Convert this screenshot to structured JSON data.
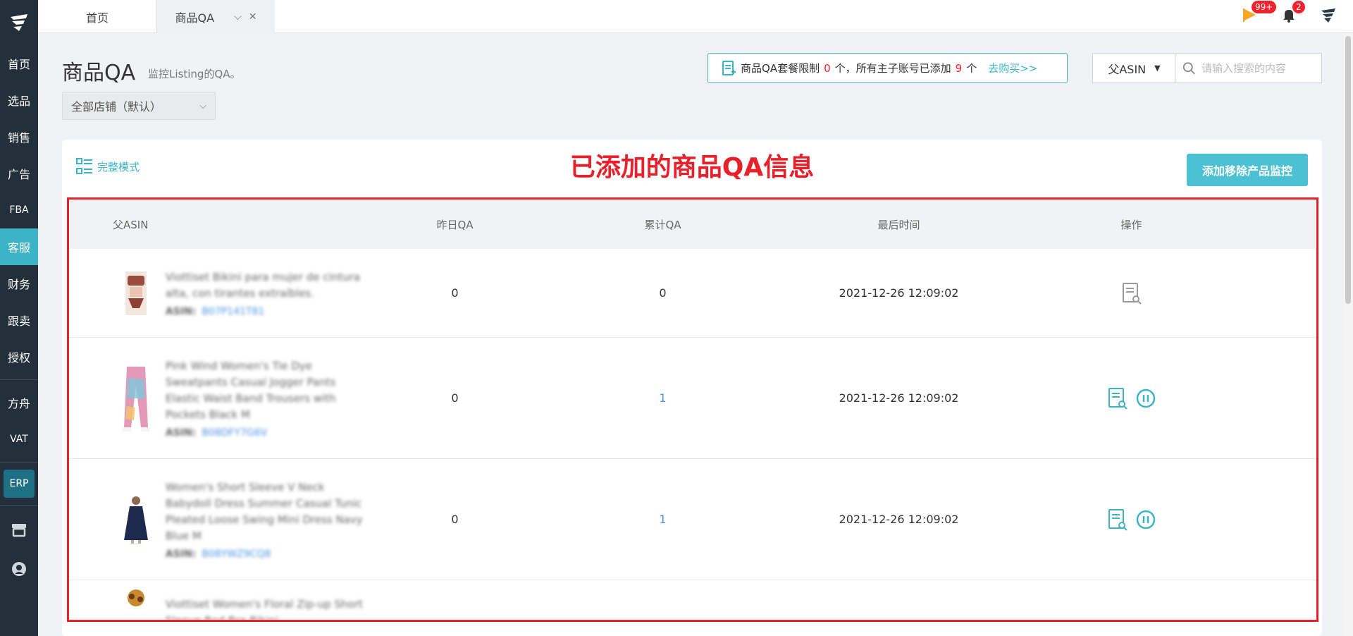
{
  "sidebar": {
    "items": [
      {
        "label": "首页"
      },
      {
        "label": "选品"
      },
      {
        "label": "销售"
      },
      {
        "label": "广告"
      },
      {
        "label": "FBA"
      },
      {
        "label": "客服"
      },
      {
        "label": "财务"
      },
      {
        "label": "跟卖"
      },
      {
        "label": "授权"
      },
      {
        "label": "方舟"
      },
      {
        "label": "VAT"
      }
    ],
    "active_index": 5,
    "erp_label": "ERP",
    "active_color": "#3cb4c8"
  },
  "tabs": {
    "home": "首页",
    "qa": "商品QA"
  },
  "notifications": {
    "flag_count": "99+",
    "bell_count": "2"
  },
  "header": {
    "title": "商品QA",
    "subtitle": "监控Listing的QA。",
    "store_select": "全部店铺（默认）",
    "quota": {
      "prefix": "商品QA套餐限制",
      "limit": "0",
      "unit1": "个，所有主子账号已添加",
      "added": "9",
      "unit2": "个",
      "buy_link": "去购买>>"
    },
    "search": {
      "type": "父ASIN",
      "placeholder": "请输入搜索的内容"
    }
  },
  "card": {
    "mode_link": "完整模式",
    "annotation": "已添加的商品QA信息",
    "add_button": "添加移除产品监控"
  },
  "table": {
    "headers": {
      "asin": "父ASIN",
      "yesterday": "昨日QA",
      "total": "累计QA",
      "last_time": "最后时间",
      "ops": "操作"
    },
    "asin_label": "ASIN:",
    "rows": [
      {
        "name": "Viottiset Bikini para mujer de cintura alta, con tirantes extraíbles.",
        "asin": "B07P141T81",
        "yesterday": "0",
        "total": "0",
        "last_time": "2021-12-26 12:09:02"
      },
      {
        "name": "Pink Wind Women's Tie Dye Sweatpants Casual Jogger Pants Elastic Waist Band Trousers with Pockets Black M",
        "asin": "B08DFY7G6V",
        "yesterday": "0",
        "total": "1",
        "last_time": "2021-12-26 12:09:02"
      },
      {
        "name": "Women's Short Sleeve V Neck Babydoll Dress Summer Casual Tunic Pleated Loose Swing Mini Dress Navy Blue M",
        "asin": "B08YWZ9CQ8",
        "yesterday": "0",
        "total": "1",
        "last_time": "2021-12-26 12:09:02"
      },
      {
        "name": "Viottiset Women's Floral Zip-up Short Sleeve Bod Bra Bikini",
        "asin": "",
        "yesterday": "",
        "total": "",
        "last_time": ""
      }
    ]
  }
}
